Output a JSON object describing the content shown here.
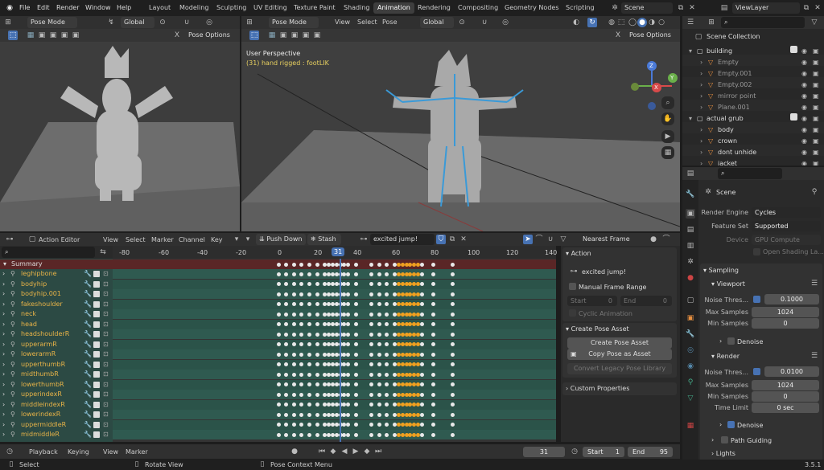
{
  "topbar": {
    "menus": [
      "File",
      "Edit",
      "Render",
      "Window",
      "Help"
    ],
    "workspaces": [
      "Layout",
      "Modeling",
      "Sculpting",
      "UV Editing",
      "Texture Paint",
      "Shading",
      "Animation",
      "Rendering",
      "Compositing",
      "Geometry Nodes",
      "Scripting"
    ],
    "active_workspace": "Animation",
    "scene": "Scene",
    "view_layer": "ViewLayer"
  },
  "viewport_left": {
    "mode": "Pose Mode",
    "transform": "Global",
    "pose_options": "Pose Options"
  },
  "viewport_main": {
    "mode": "Pose Mode",
    "menus": [
      "View",
      "Select",
      "Pose"
    ],
    "transform": "Global",
    "pose_options": "Pose Options",
    "perspective": "User Perspective",
    "info": "(31) hand rigged : footLIK",
    "gizmo": {
      "x": "X",
      "y": "Y",
      "z": "Z"
    }
  },
  "action_editor": {
    "editor_type": "Action Editor",
    "menus": [
      "View",
      "Select",
      "Marker",
      "Channel",
      "Key"
    ],
    "push_down": "Push Down",
    "stash": "Stash",
    "action_name": "excited jump!",
    "snapping": "Nearest Frame",
    "ruler": [
      "-80",
      "-60",
      "-40",
      "-20",
      "0",
      "20",
      "31",
      "40",
      "60",
      "80",
      "100",
      "120",
      "140"
    ],
    "current_frame": "31",
    "summary": "Summary",
    "channels": [
      "leghipbone",
      "bodyhip",
      "bodyhip.001",
      "fakeshoulder",
      "neck",
      "head",
      "headshoulderR",
      "upperarmR",
      "lowerarmR",
      "upperthumbR",
      "midthumbR",
      "lowerthumbR",
      "upperindexR",
      "middleindexR",
      "lowerindexR",
      "uppermiddleR",
      "midmiddleR"
    ]
  },
  "sidebar_panel": {
    "action_header": "Action",
    "action_name": "excited jump!",
    "manual_frame_range": "Manual Frame Range",
    "start_label": "Start",
    "start_value": "0",
    "end_label": "End",
    "end_value": "0",
    "cyclic": "Cyclic Animation",
    "create_pose_header": "Create Pose Asset",
    "create_pose_btn": "Create Pose Asset",
    "copy_pose_btn": "Copy Pose as Asset",
    "convert_btn": "Convert Legacy Pose Library",
    "custom_props": "Custom Properties"
  },
  "timeline": {
    "menus": [
      "Playback",
      "Keying",
      "View",
      "Marker"
    ],
    "current_frame": "31",
    "start_label": "Start",
    "start_value": "1",
    "end_label": "End",
    "end_value": "95"
  },
  "statusbar": {
    "select": "Select",
    "rotate": "Rotate View",
    "context": "Pose Context Menu",
    "version": "3.5.1"
  },
  "outliner": {
    "root": "Scene Collection",
    "rows": [
      {
        "name": "building",
        "level": 1
      },
      {
        "name": "Empty",
        "level": 2
      },
      {
        "name": "Empty.001",
        "level": 2
      },
      {
        "name": "Empty.002",
        "level": 2
      },
      {
        "name": "mirror point",
        "level": 2
      },
      {
        "name": "Plane.001",
        "level": 2
      },
      {
        "name": "actual grub",
        "level": 1
      },
      {
        "name": "body",
        "level": 2
      },
      {
        "name": "crown",
        "level": 2
      },
      {
        "name": "dont unhide",
        "level": 2
      },
      {
        "name": "jacket",
        "level": 2
      }
    ]
  },
  "properties": {
    "scene": "Scene",
    "render_engine_label": "Render Engine",
    "render_engine": "Cycles",
    "feature_set_label": "Feature Set",
    "feature_set": "Supported",
    "device_label": "Device",
    "device": "GPU Compute",
    "osl": "Open Shading La...",
    "sampling": "Sampling",
    "viewport": "Viewport",
    "noise_thresh_label": "Noise Thres...",
    "vp_noise": "0.1000",
    "max_samples_label": "Max Samples",
    "vp_max": "1024",
    "min_samples_label": "Min Samples",
    "vp_min": "0",
    "denoise": "Denoise",
    "render": "Render",
    "r_noise": "0.0100",
    "r_max": "1024",
    "r_min": "0",
    "time_limit_label": "Time Limit",
    "time_limit": "0 sec",
    "denoise2": "Denoise",
    "path_guiding": "Path Guiding",
    "lights": "Lights"
  }
}
